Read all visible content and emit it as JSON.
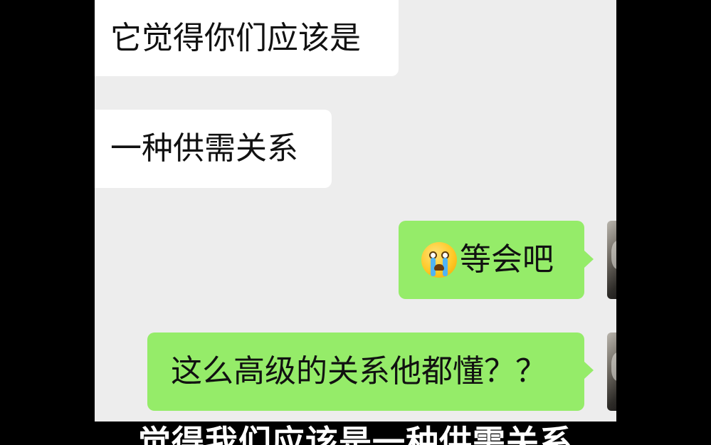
{
  "messages": [
    {
      "side": "left",
      "text": "它觉得你们应该是"
    },
    {
      "side": "left",
      "text": "一种供需关系"
    },
    {
      "side": "right",
      "emoji": "loudly-crying-face",
      "text": "等会吧"
    },
    {
      "side": "right",
      "text": "这么高级的关系他都懂？？"
    }
  ],
  "subtitle": "觉得我们应该是一种供需关系",
  "colors": {
    "background": "#000000",
    "chat_bg": "#ededed",
    "incoming_bubble": "#ffffff",
    "outgoing_bubble": "#95ec69",
    "subtitle_text": "#ffffff"
  }
}
